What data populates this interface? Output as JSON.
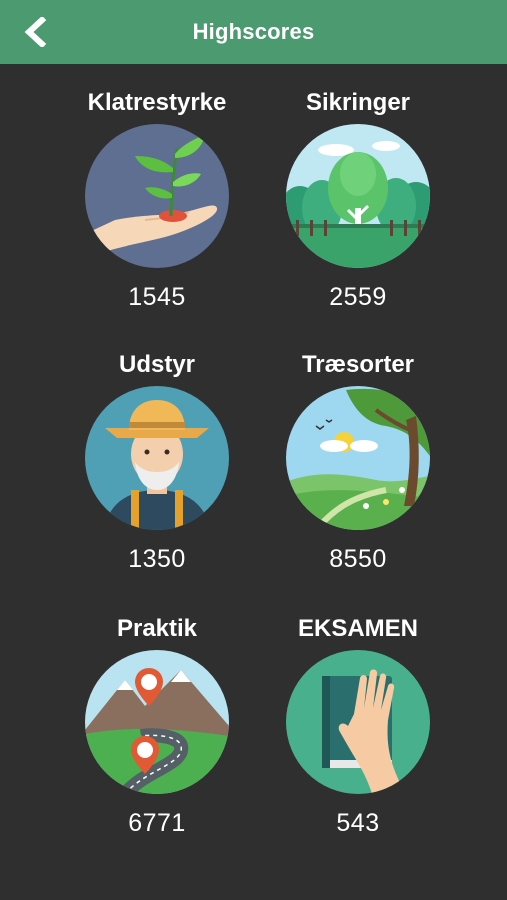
{
  "header": {
    "title": "Highscores",
    "back_icon": "chevron-left-icon"
  },
  "colors": {
    "header_bg": "#4c9a6f",
    "page_bg": "#2f2f2f",
    "text": "#ffffff"
  },
  "categories": [
    {
      "label": "Klatrestyrke",
      "score": "1545",
      "icon": "sprout-in-hand-icon"
    },
    {
      "label": "Sikringer",
      "score": "2559",
      "icon": "forest-trees-icon"
    },
    {
      "label": "Udstyr",
      "score": "1350",
      "icon": "farmer-avatar-icon"
    },
    {
      "label": "Træsorter",
      "score": "8550",
      "icon": "landscape-tree-icon"
    },
    {
      "label": "Praktik",
      "score": "6771",
      "icon": "mountain-road-map-pins-icon"
    },
    {
      "label": "EKSAMEN",
      "score": "543",
      "icon": "book-hand-icon"
    }
  ]
}
